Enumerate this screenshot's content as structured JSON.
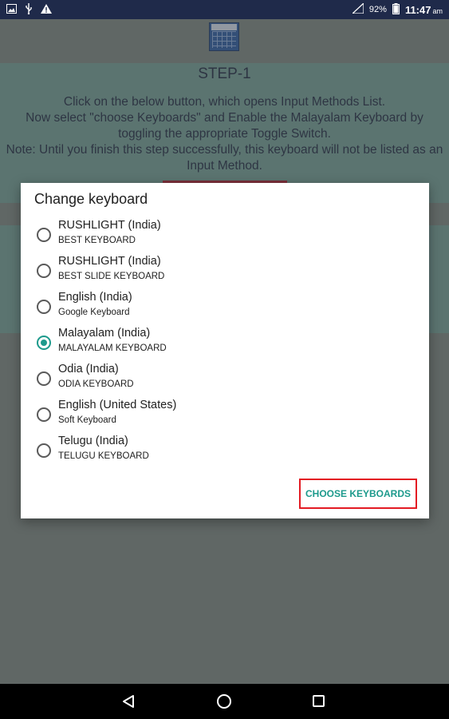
{
  "status_bar": {
    "battery_percent": "92%",
    "time": "11:47",
    "ampm": "am",
    "icons": [
      "image-icon",
      "usb-icon",
      "warning-icon",
      "signal-icon",
      "battery-icon"
    ]
  },
  "app": {
    "step_title": "STEP-1",
    "instructions": [
      "Click on the below button, which opens Input Methods List.",
      "Now select \"choose Keyboards\" and Enable the Malayalam Keyboard by toggling the appropriate Toggle Switch.",
      "Note: Until you finish this step successfully, this keyboard will not be listed as an Input Method."
    ]
  },
  "dialog": {
    "title": "Change keyboard",
    "options": [
      {
        "name": "RUSHLIGHT (India)",
        "sub": "BEST KEYBOARD",
        "selected": false
      },
      {
        "name": "RUSHLIGHT (India)",
        "sub": "BEST SLIDE KEYBOARD",
        "selected": false
      },
      {
        "name": "English (India)",
        "sub": "Google Keyboard",
        "selected": false
      },
      {
        "name": "Malayalam (India)",
        "sub": "MALAYALAM KEYBOARD",
        "selected": true
      },
      {
        "name": "Odia (India)",
        "sub": "ODIA KEYBOARD",
        "selected": false
      },
      {
        "name": "English (United States)",
        "sub": "Soft Keyboard",
        "selected": false
      },
      {
        "name": "Telugu (India)",
        "sub": "TELUGU KEYBOARD",
        "selected": false
      }
    ],
    "action_label": "CHOOSE KEYBOARDS"
  },
  "colors": {
    "accent": "#1d9a8c",
    "highlight_border": "#e31b23",
    "status_bar": "#1f2a4a"
  },
  "nav_bar": {
    "icons": [
      "back-icon",
      "home-icon",
      "recents-icon"
    ]
  }
}
